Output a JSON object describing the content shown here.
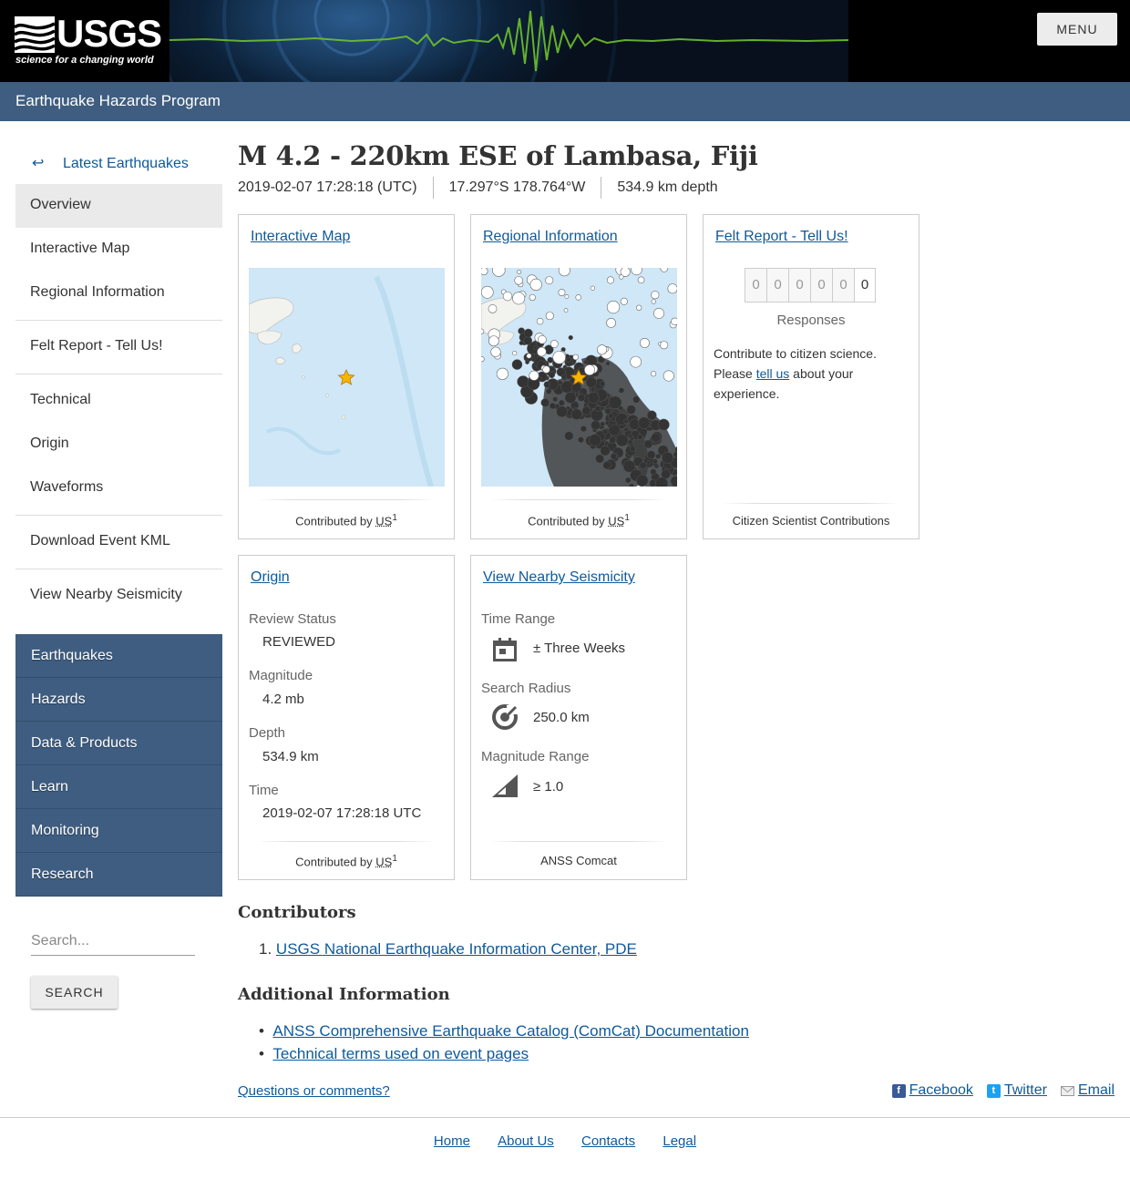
{
  "header": {
    "logo_text": "USGS",
    "logo_tagline": "science for a changing world",
    "menu_label": "MENU"
  },
  "program_title": "Earthquake Hazards Program",
  "sidebar": {
    "back_label": "Latest Earthquakes",
    "items": [
      {
        "label": "Overview",
        "active": true
      },
      {
        "label": "Interactive Map"
      },
      {
        "label": "Regional Information"
      },
      {
        "label": "Felt Report - Tell Us!"
      },
      {
        "label": "Technical"
      },
      {
        "label": "Origin"
      },
      {
        "label": "Waveforms"
      },
      {
        "label": "Download Event KML"
      },
      {
        "label": "View Nearby Seismicity"
      }
    ]
  },
  "site_nav": [
    "Earthquakes",
    "Hazards",
    "Data & Products",
    "Learn",
    "Monitoring",
    "Research"
  ],
  "search": {
    "placeholder": "Search...",
    "button": "SEARCH"
  },
  "event": {
    "title": "M 4.2 - 220km ESE of Lambasa, Fiji",
    "time": "2019-02-07 17:28:18 (UTC)",
    "coords": "17.297°S 178.764°W",
    "depth": "534.9 km depth"
  },
  "cards": {
    "interactive_map": {
      "title": "Interactive Map",
      "contrib": "Contributed by",
      "source": "US",
      "sup": "1"
    },
    "regional": {
      "title": "Regional Information",
      "contrib": "Contributed by",
      "source": "US",
      "sup": "1"
    },
    "felt": {
      "title": "Felt Report - Tell Us!",
      "digits": [
        "0",
        "0",
        "0",
        "0",
        "0",
        "0"
      ],
      "responses_label": "Responses",
      "text_before": "Contribute to citizen science. Please ",
      "link": "tell us",
      "text_after": " about your experience.",
      "foot": "Citizen Scientist Contributions"
    },
    "origin": {
      "title": "Origin",
      "review_label": "Review Status",
      "review_value": "REVIEWED",
      "mag_label": "Magnitude",
      "mag_value": "4.2 mb",
      "depth_label": "Depth",
      "depth_value": "534.9 km",
      "time_label": "Time",
      "time_value": "2019-02-07 17:28:18 UTC",
      "contrib": "Contributed by",
      "source": "US",
      "sup": "1"
    },
    "nearby": {
      "title": "View Nearby Seismicity",
      "time_label": "Time Range",
      "time_value": "± Three Weeks",
      "radius_label": "Search Radius",
      "radius_value": "250.0 km",
      "mag_label": "Magnitude Range",
      "mag_value": "≥ 1.0",
      "foot": "ANSS Comcat",
      "icons": [
        "calendar-icon",
        "target-icon",
        "magnitude-ramp-icon"
      ]
    }
  },
  "contributors": {
    "heading": "Contributors",
    "items": [
      {
        "num": "1.",
        "label": "USGS National Earthquake Information Center, PDE"
      }
    ]
  },
  "additional": {
    "heading": "Additional Information",
    "items": [
      "ANSS Comprehensive Earthquake Catalog (ComCat) Documentation",
      "Technical terms used on event pages"
    ]
  },
  "questions": "Questions or comments?",
  "social": {
    "facebook": "Facebook",
    "twitter": "Twitter",
    "email": "Email"
  },
  "footer": [
    "Home",
    "About Us",
    "Contacts",
    "Legal"
  ],
  "colors": {
    "accent_blue": "#3e5d80",
    "link": "#0e5a9b",
    "seismo_green": "#6fc12e",
    "map_water": "#cfe7f7"
  }
}
